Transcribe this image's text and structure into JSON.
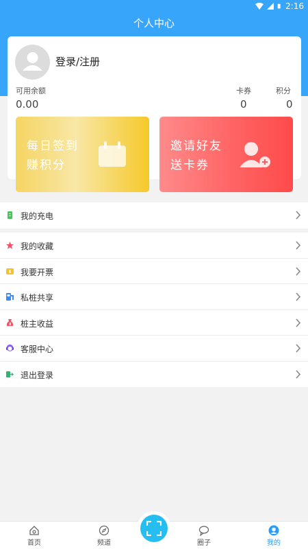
{
  "status_bar": {
    "time": "2:16"
  },
  "header": {
    "title": "个人中心"
  },
  "profile": {
    "login_label": "登录/注册",
    "balance_label": "可用余额",
    "balance_value": "0.00",
    "coupon_label": "卡券",
    "coupon_value": "0",
    "points_label": "积分",
    "points_value": "0"
  },
  "promos": {
    "signin": {
      "line1": "每日签到",
      "line2": "赚积分"
    },
    "invite": {
      "line1": "邀请好友",
      "line2": "送卡券"
    }
  },
  "menu": {
    "charging": "我的充电",
    "items": [
      {
        "label": "我的收藏",
        "icon": "star-icon",
        "color": "#f0556b"
      },
      {
        "label": "我要开票",
        "icon": "invoice-icon",
        "color": "#f6c12e"
      },
      {
        "label": "私桩共享",
        "icon": "charger-icon",
        "color": "#3d8af7"
      },
      {
        "label": "桩主收益",
        "icon": "money-bag-icon",
        "color": "#f0556b"
      },
      {
        "label": "客服中心",
        "icon": "service-icon",
        "color": "#8b5cf6"
      },
      {
        "label": "退出登录",
        "icon": "logout-icon",
        "color": "#2bb673"
      }
    ]
  },
  "tabbar": {
    "home": "首页",
    "channel": "频道",
    "circle": "圈子",
    "mine": "我的"
  },
  "colors": {
    "accent": "#37a5fa",
    "active_tab": "#2d9cf5",
    "scan_button": "#26bdf0"
  }
}
